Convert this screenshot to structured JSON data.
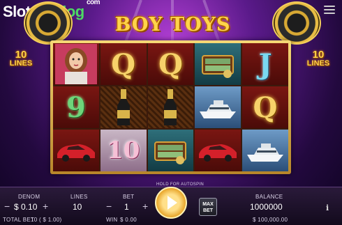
{
  "logo": {
    "brand_a": "Slot",
    "brand_b": "Catalog",
    "suffix": "com"
  },
  "game_title": "BOY TOYS",
  "lines_badge": {
    "number": "10",
    "label": "LINES"
  },
  "reels": [
    [
      "girl",
      "Q",
      "Q",
      "money",
      "J"
    ],
    [
      "9",
      "champagne",
      "champagne",
      "yacht",
      "Q"
    ],
    [
      "car",
      "10",
      "money",
      "car",
      "yacht"
    ]
  ],
  "controls": {
    "denom_label": "DENOM",
    "denom_value": "$ 0.10",
    "lines_label": "LINES",
    "lines_value": "10",
    "bet_label": "BET",
    "bet_value": "1",
    "spin_arc_label": "HOLD FOR AUTOSPIN",
    "maxbet_line1": "MAX",
    "maxbet_line2": "BET",
    "balance_label": "BALANCE",
    "balance_value": "1000000",
    "total_bet_label": "TOTAL BET",
    "total_bet_value": "10 ( $ 1.00)",
    "win_label": "WIN",
    "win_value": "$ 0.00",
    "balance_money": "$ 100,000.00",
    "minus": "−",
    "plus": "+",
    "info": "i"
  },
  "colors": {
    "frame_gold": "#d9a93c",
    "title_gold": "#ffd44a",
    "brand_green": "#4cd964"
  }
}
